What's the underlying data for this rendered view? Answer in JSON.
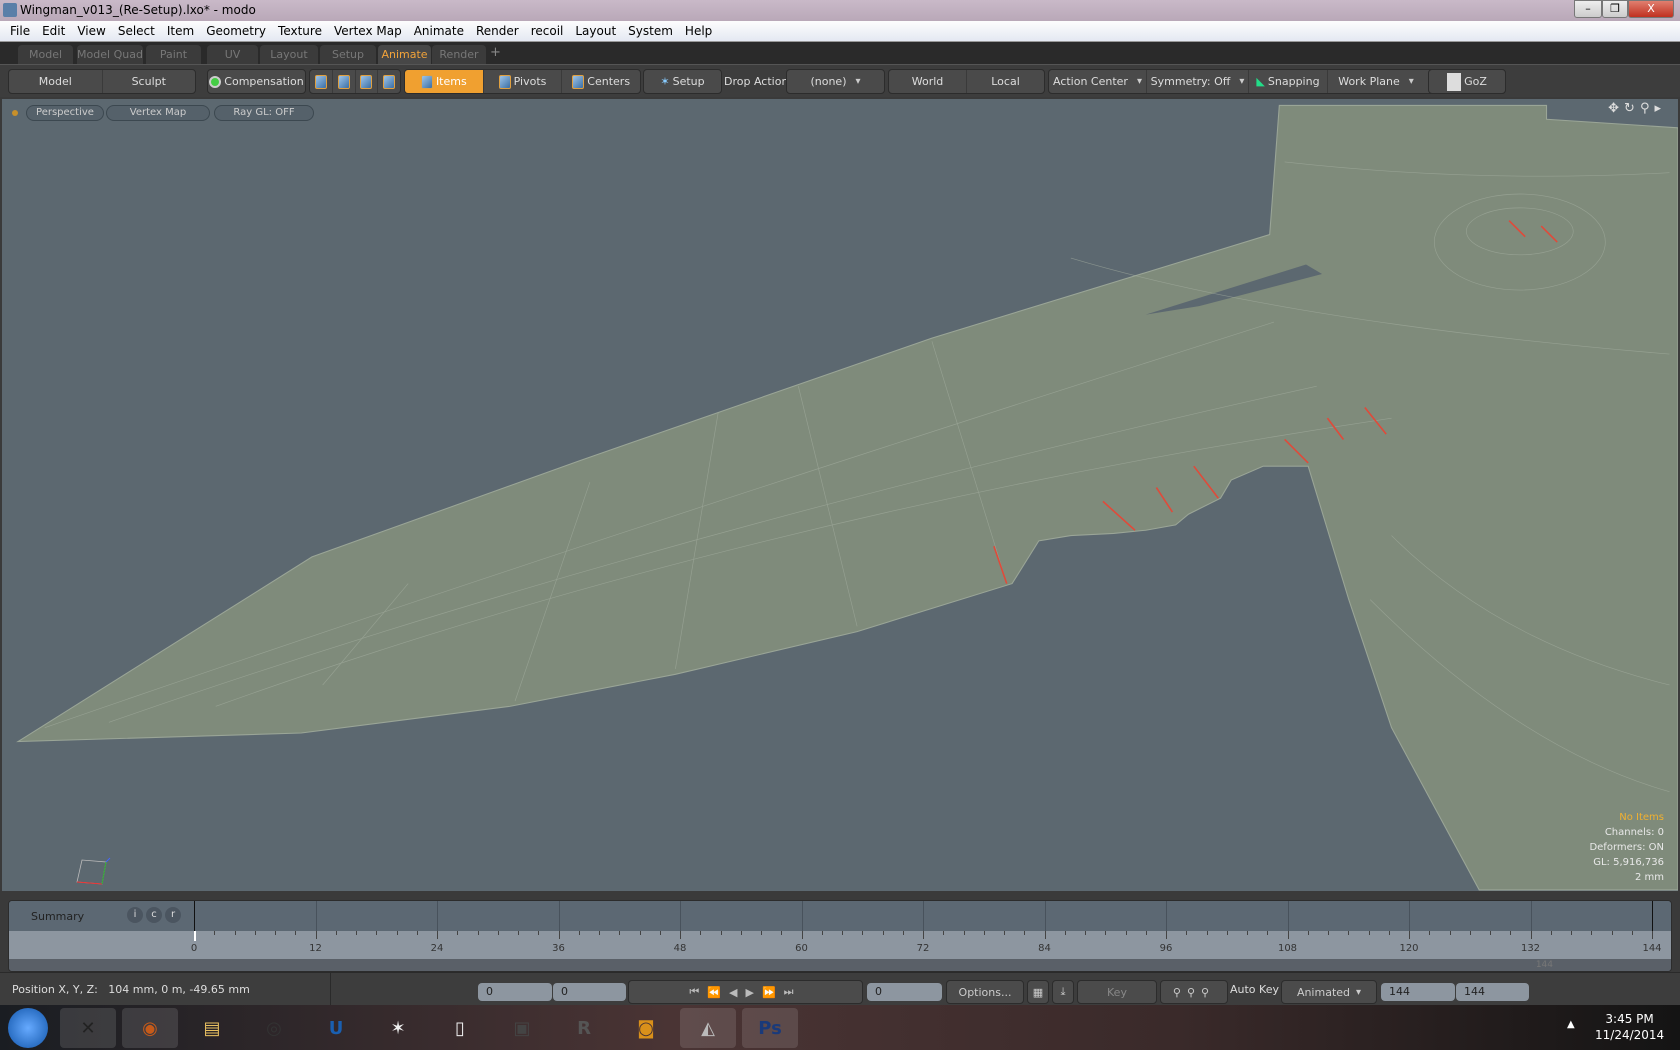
{
  "window": {
    "title": "Wingman_v013_(Re-Setup).lxo* - modo",
    "minimize": "–",
    "restore": "❐",
    "close": "X"
  },
  "menu": [
    "File",
    "Edit",
    "View",
    "Select",
    "Item",
    "Geometry",
    "Texture",
    "Vertex Map",
    "Animate",
    "Render",
    "recoil",
    "Layout",
    "System",
    "Help"
  ],
  "layout_tabs": [
    "Model",
    "Model Quad",
    "Paint",
    "UV",
    "Layout",
    "Setup",
    "Animate",
    "Render"
  ],
  "active_tab": "Animate",
  "add_tab": "+",
  "toolbar": {
    "model": "Model",
    "sculpt": "Sculpt",
    "compensation": "Compensation",
    "items": "Items",
    "pivots": "Pivots",
    "centers": "Centers",
    "setup": "Setup",
    "drop_action_label": "Drop Action",
    "drop_action_value": "(none)",
    "world": "World",
    "local": "Local",
    "action_center": "Action Center",
    "symmetry": "Symmetry: Off",
    "snapping": "Snapping",
    "work_plane": "Work Plane",
    "goz": "GoZ"
  },
  "viewport": {
    "view": "Perspective",
    "vertex_map": "Vertex Map",
    "ray_gl": "Ray GL: OFF",
    "info": {
      "items": "No Items",
      "channels": "Channels: 0",
      "deformers": "Deformers: ON",
      "gl": "GL: 5,916,736",
      "scale": "2 mm"
    },
    "colors": {
      "background": "#5c6870",
      "mesh": "#7f8b7b",
      "selection": "#e04a3a",
      "info_highlight": "#f0b030"
    }
  },
  "timeline": {
    "summary": "Summary",
    "flags": [
      "i",
      "c",
      "r"
    ],
    "ticks": [
      "0",
      "12",
      "24",
      "36",
      "48",
      "60",
      "72",
      "84",
      "96",
      "108",
      "120",
      "132",
      "144"
    ],
    "scroll_end": "144",
    "current_frame": 0
  },
  "status": {
    "position": "Position X, Y, Z:   104 mm, 0 m, -49.65 mm",
    "field1": "0",
    "field2": "0",
    "field3": "0",
    "options": "Options...",
    "key": "Key",
    "auto_key": "Auto Key",
    "animated": "Animated",
    "end1": "144",
    "end2": "144"
  },
  "taskbar": {
    "apps": [
      "modo",
      "Firefox",
      "Explorer",
      "Color",
      "Unreal",
      "ZBrush",
      "Document",
      "Media",
      "Recap",
      "Camera",
      "Preview",
      "Ps"
    ],
    "time": "3:45 PM",
    "date": "11/24/2014"
  }
}
